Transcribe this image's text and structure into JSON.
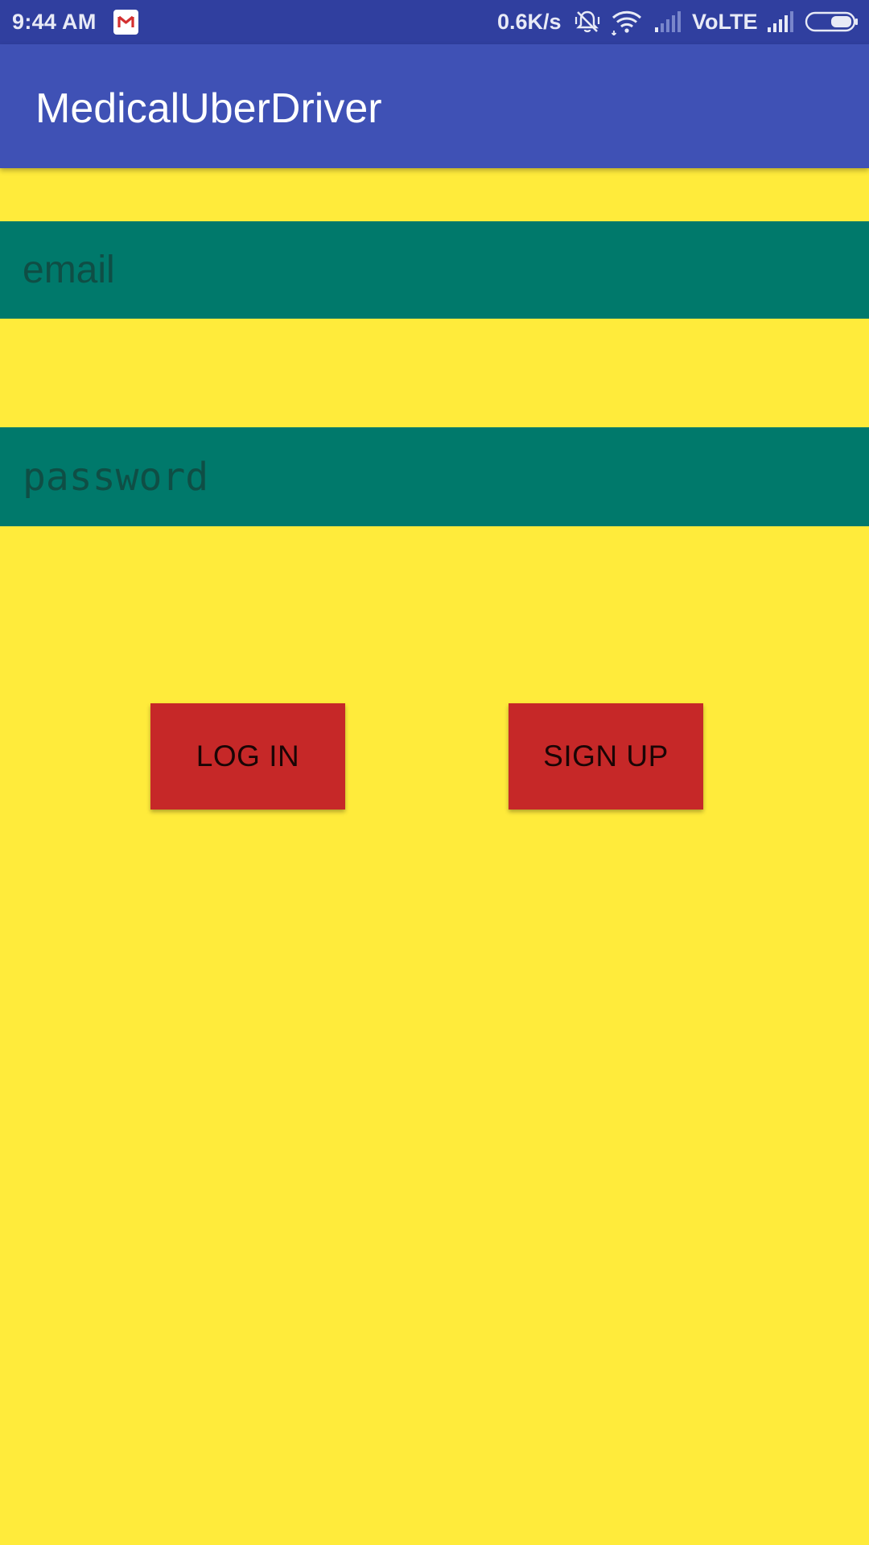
{
  "status_bar": {
    "time": "9:44 AM",
    "network_speed": "0.6K/s",
    "volte": "VoLTE",
    "icons": [
      "gmail-icon",
      "mute-icon",
      "wifi-icon",
      "signal-icon",
      "signal-icon",
      "battery-icon"
    ]
  },
  "app_bar": {
    "title": "MedicalUberDriver",
    "color": "#3F51B5"
  },
  "form": {
    "email": {
      "placeholder": "email",
      "value": ""
    },
    "password": {
      "placeholder": "password",
      "value": ""
    },
    "login_label": "LOG IN",
    "signup_label": "SIGN UP"
  },
  "colors": {
    "background": "#FFEB3B",
    "field": "#00796B",
    "button": "#C62828",
    "status_bar": "#303F9F"
  }
}
